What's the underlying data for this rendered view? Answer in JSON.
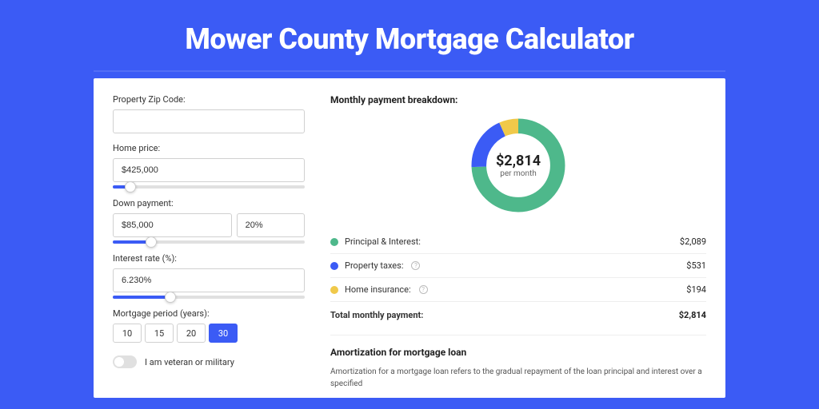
{
  "title": "Mower County Mortgage Calculator",
  "form": {
    "zip_label": "Property Zip Code:",
    "zip_value": "",
    "home_price_label": "Home price:",
    "home_price_value": "$425,000",
    "home_price_slider_pct": 9,
    "down_payment_label": "Down payment:",
    "down_payment_value": "$85,000",
    "down_payment_pct": "20%",
    "down_payment_slider_pct": 20,
    "interest_label": "Interest rate (%):",
    "interest_value": "6.230%",
    "interest_slider_pct": 30,
    "period_label": "Mortgage period (years):",
    "periods": [
      "10",
      "15",
      "20",
      "30"
    ],
    "period_active": "30",
    "veteran_label": "I am veteran or military"
  },
  "breakdown": {
    "title": "Monthly payment breakdown:",
    "center_amount": "$2,814",
    "center_sub": "per month",
    "items": [
      {
        "label": "Principal & Interest:",
        "value": "$2,089",
        "color": "green",
        "info": false
      },
      {
        "label": "Property taxes:",
        "value": "$531",
        "color": "blue",
        "info": true
      },
      {
        "label": "Home insurance:",
        "value": "$194",
        "color": "yellow",
        "info": true
      }
    ],
    "total_label": "Total monthly payment:",
    "total_value": "$2,814"
  },
  "amort": {
    "title": "Amortization for mortgage loan",
    "text": "Amortization for a mortgage loan refers to the gradual repayment of the loan principal and interest over a specified"
  },
  "chart_data": {
    "type": "pie",
    "title": "Monthly payment breakdown",
    "series": [
      {
        "name": "Principal & Interest",
        "value": 2089,
        "color": "#4eb88b"
      },
      {
        "name": "Property taxes",
        "value": 531,
        "color": "#3b5bf5"
      },
      {
        "name": "Home insurance",
        "value": 194,
        "color": "#f0c94a"
      }
    ],
    "total": 2814,
    "center_label": "$2,814 per month"
  }
}
